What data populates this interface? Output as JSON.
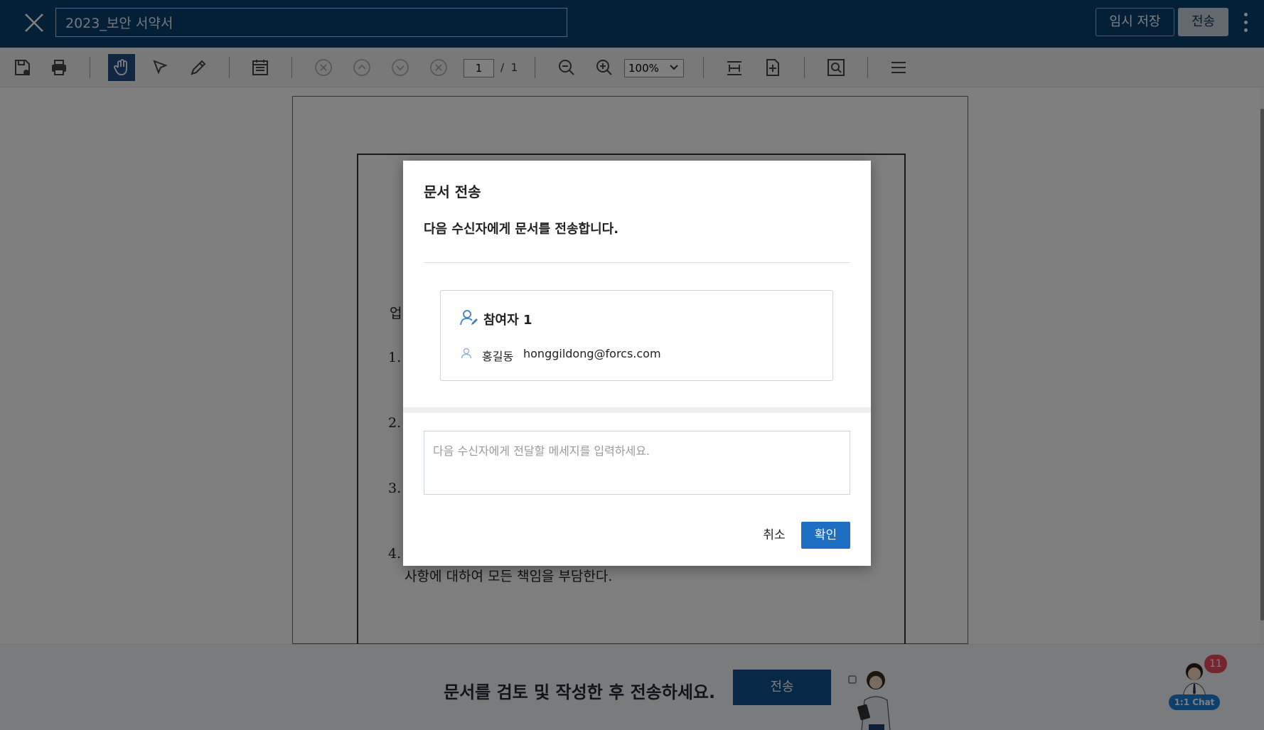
{
  "header": {
    "document_title": "2023_보안 서약서",
    "temp_save_label": "임시 저장",
    "send_label": "전송",
    "colors": {
      "header_bg": "#09406e"
    }
  },
  "toolbar": {
    "current_page": "1",
    "page_separator": "/",
    "total_pages": "1",
    "zoom": "100%",
    "icons": [
      "save-icon",
      "print-icon",
      "hand-tool-icon",
      "select-arrow-icon",
      "pen-icon",
      "annotation-list-icon",
      "first-page-icon",
      "prev-page-icon",
      "next-page-icon",
      "last-page-icon",
      "zoom-out-icon",
      "zoom-in-icon",
      "fit-width-icon",
      "fit-page-icon",
      "search-icon",
      "menu-icon"
    ]
  },
  "document": {
    "line_1": "업",
    "item_1": "1.",
    "item_2": "2.",
    "item_3": "3.",
    "item_4": "4.",
    "item_4_text": "사항에 대하여 모든 책임을 부담한다."
  },
  "modal": {
    "title": "문서 전송",
    "description": "다음 수신자에게 문서를 전송합니다.",
    "participant_title": "참여자 1",
    "participant_name": "홍길동",
    "participant_email": "honggildong@forcs.com",
    "message_placeholder": "다음 수신자에게 전달할 메세지를 입력하세요.",
    "cancel_label": "취소",
    "confirm_label": "확인",
    "colors": {
      "confirm_bg": "#1e6fc4"
    }
  },
  "bottom_bar": {
    "message": "문서를 검토 및 작성한 후 전송하세요.",
    "send_label": "전송"
  },
  "chat": {
    "label": "1:1 Chat",
    "badge_count": "11"
  }
}
